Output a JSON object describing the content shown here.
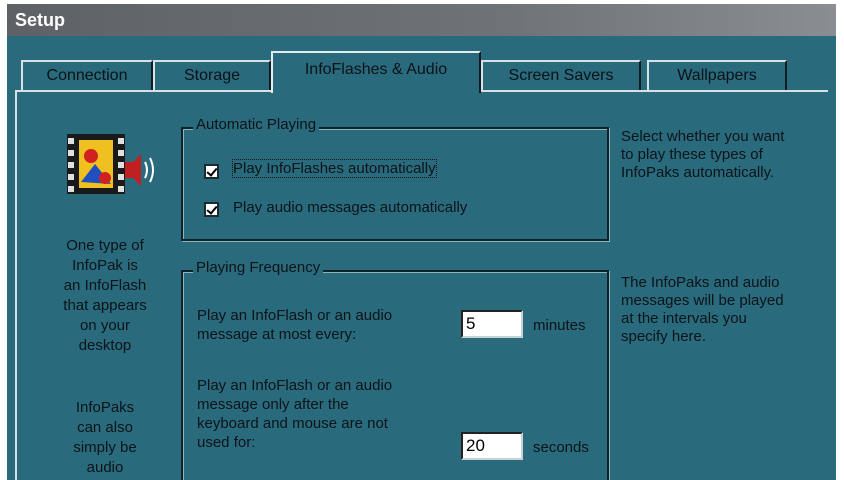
{
  "window": {
    "title": "Setup"
  },
  "tabs": [
    {
      "label": "Connection"
    },
    {
      "label": "Storage"
    },
    {
      "label": "InfoFlashes & Audio"
    },
    {
      "label": "Screen Savers"
    },
    {
      "label": "Wallpapers"
    }
  ],
  "active_tab": "InfoFlashes & Audio",
  "left_panel": {
    "icon": "film-speaker-icon",
    "text1_lines": [
      "One type of",
      "InfoPak is",
      "an InfoFlash",
      "that appears",
      "on your",
      "desktop"
    ],
    "text2_lines": [
      "InfoPaks",
      "can also",
      "simply be",
      "audio"
    ]
  },
  "automatic_playing": {
    "legend": "Automatic Playing",
    "checkbox1": {
      "label": "Play InfoFlashes automatically",
      "checked": true
    },
    "checkbox2": {
      "label": "Play audio messages automatically",
      "checked": true
    }
  },
  "playing_frequency": {
    "legend": "Playing Frequency",
    "row1_lines": [
      "Play an InfoFlash or an audio",
      "message at most every:"
    ],
    "row1_value": "5",
    "row1_unit": "minutes",
    "row2_lines": [
      "Play an InfoFlash or an audio",
      "message only after the",
      "keyboard and mouse are not",
      "used for:"
    ],
    "row2_value": "20",
    "row2_unit": "seconds"
  },
  "right_help": {
    "help1_lines": [
      "Select whether you want",
      "to play these types of",
      "InfoPaks automatically."
    ],
    "help2_lines": [
      "The InfoPaks and audio",
      "messages will be played",
      "at the intervals you",
      "specify here."
    ]
  },
  "colors": {
    "background": "#2a6a7d",
    "titlebar": "#6a6e72",
    "text": "#0c1418"
  }
}
